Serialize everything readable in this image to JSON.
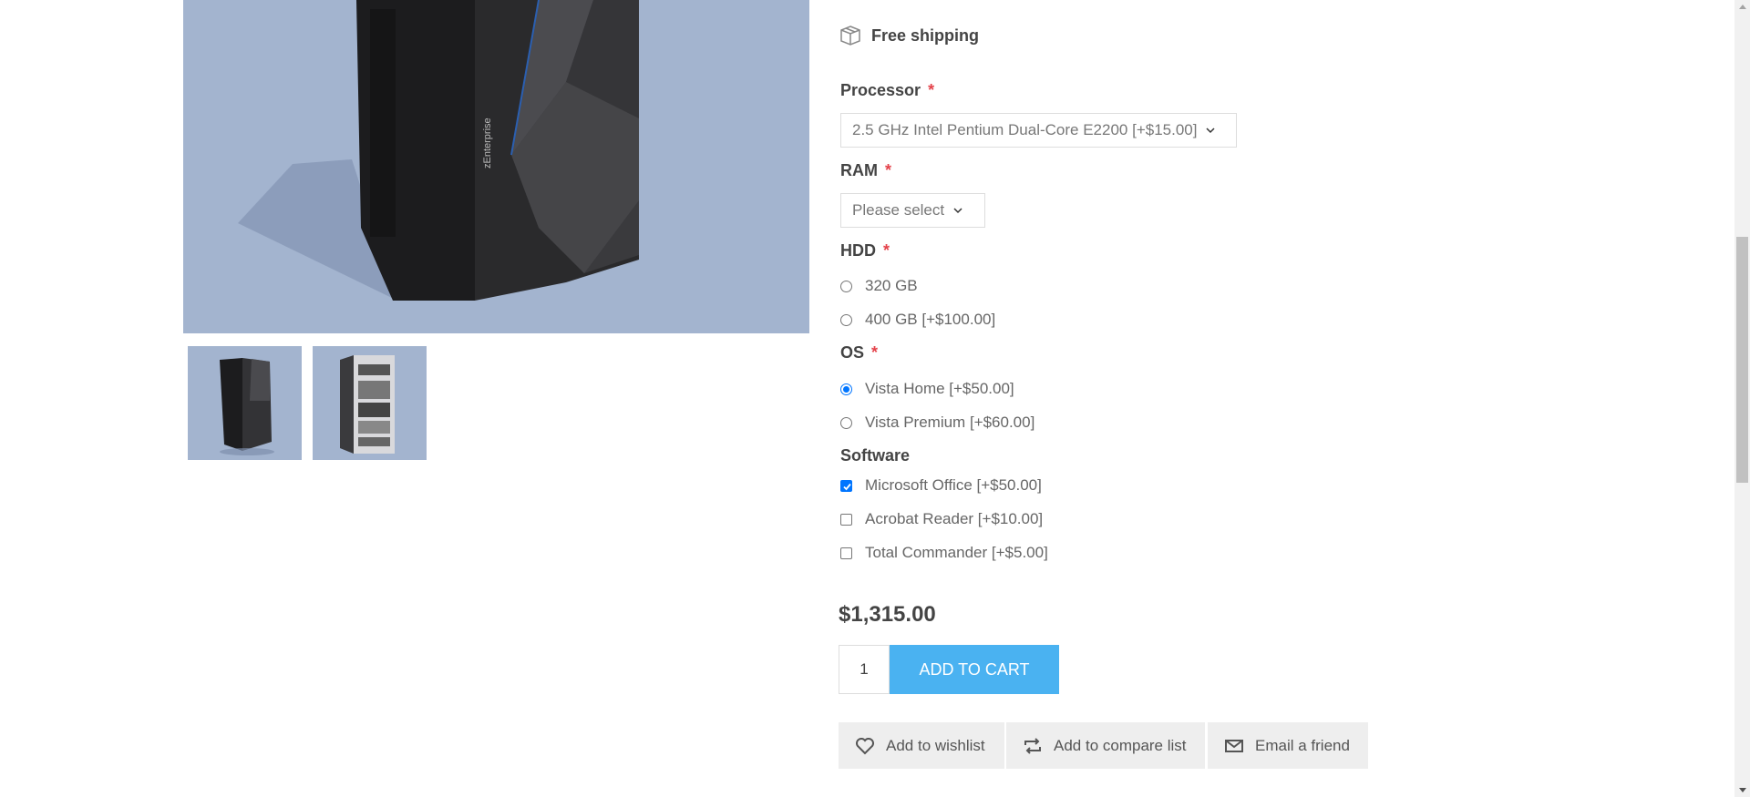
{
  "product": {
    "shipping_label": "Free shipping",
    "attributes": {
      "processor": {
        "label": "Processor",
        "required_mark": "*",
        "selected": "2.5 GHz Intel Pentium Dual-Core E2200 [+$15.00]"
      },
      "ram": {
        "label": "RAM",
        "required_mark": "*",
        "selected": "Please select"
      },
      "hdd": {
        "label": "HDD",
        "required_mark": "*",
        "options": [
          {
            "label": "320 GB",
            "checked": false
          },
          {
            "label": "400 GB [+$100.00]",
            "checked": false
          }
        ]
      },
      "os": {
        "label": "OS",
        "required_mark": "*",
        "options": [
          {
            "label": "Vista Home [+$50.00]",
            "checked": true
          },
          {
            "label": "Vista Premium [+$60.00]",
            "checked": false
          }
        ]
      },
      "software": {
        "label": "Software",
        "options": [
          {
            "label": "Microsoft Office [+$50.00]",
            "checked": true
          },
          {
            "label": "Acrobat Reader [+$10.00]",
            "checked": false
          },
          {
            "label": "Total Commander [+$5.00]",
            "checked": false
          }
        ]
      }
    },
    "price": "$1,315.00",
    "quantity": "1",
    "add_to_cart_label": "ADD TO CART",
    "actions": {
      "wishlist": "Add to wishlist",
      "compare": "Add to compare list",
      "email": "Email a friend"
    }
  },
  "colors": {
    "accent": "#4ab2f1",
    "required": "#e4434b",
    "image_bg": "#a3b4cf",
    "checkbox": "#0075ff"
  },
  "icons": [
    "box-icon",
    "chevron-down-icon",
    "heart-icon",
    "compare-arrows-icon",
    "envelope-icon"
  ]
}
